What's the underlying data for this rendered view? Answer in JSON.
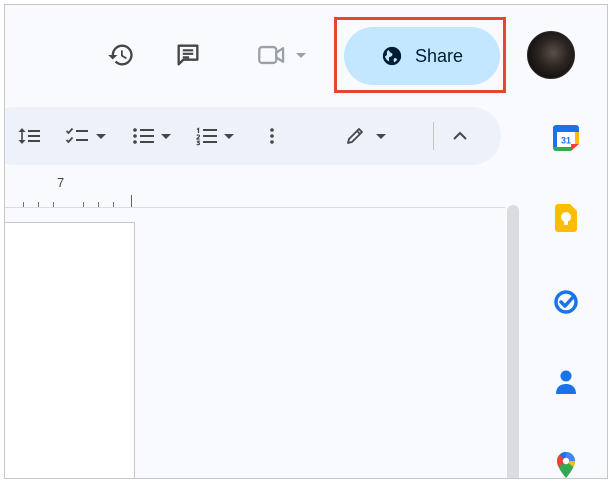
{
  "header": {
    "share_label": "Share"
  },
  "ruler": {
    "marker": "7"
  },
  "side_panel": {
    "calendar_date": "31"
  },
  "colors": {
    "share_bg": "#c2e7ff",
    "highlight": "#e8442e",
    "toolbar_bg": "#edf2fa",
    "calendar_blue": "#1a73e8",
    "keep_yellow": "#fbbc04",
    "tasks_blue": "#1a73e8",
    "contacts_blue": "#1a73e8"
  },
  "icons": [
    "history-icon",
    "comment-icon",
    "video-call-icon",
    "globe-icon",
    "line-spacing-icon",
    "checklist-icon",
    "bulleted-list-icon",
    "numbered-list-icon",
    "more-vert-icon",
    "edit-pencil-icon",
    "chevron-up-icon",
    "calendar-icon",
    "keep-icon",
    "tasks-icon",
    "contacts-icon",
    "maps-icon"
  ]
}
